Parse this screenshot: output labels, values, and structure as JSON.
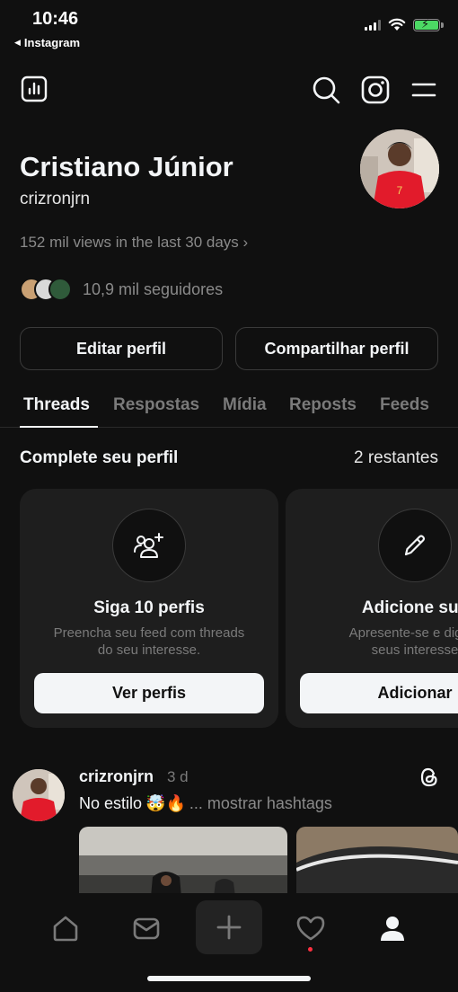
{
  "status_bar": {
    "time": "10:46",
    "back_app": "Instagram",
    "battery_color": "#4cd964"
  },
  "header": {
    "left_icon": "insights-chart-icon",
    "right_icons": [
      "search-icon",
      "instagram-icon",
      "menu-icon"
    ]
  },
  "profile": {
    "name": "Cristiano Júnior",
    "handle": "crizronjrn",
    "views": "152 mil views in the last 30 days",
    "followers": "10,9 mil seguidores",
    "edit_button": "Editar perfil",
    "share_button": "Compartilhar perfil"
  },
  "tabs": [
    {
      "label": "Threads",
      "active": true
    },
    {
      "label": "Respostas",
      "active": false
    },
    {
      "label": "Mídia",
      "active": false
    },
    {
      "label": "Reposts",
      "active": false
    },
    {
      "label": "Feeds",
      "active": false
    }
  ],
  "complete_profile": {
    "title": "Complete seu perfil",
    "remaining": "2 restantes",
    "cards": [
      {
        "icon": "add-people-icon",
        "title": "Siga 10 perfis",
        "description": "Preencha seu feed com threads\ndo seu interesse.",
        "button": "Ver perfis"
      },
      {
        "icon": "pencil-icon",
        "title": "Adicione sua",
        "description": "Apresente-se e diga o\nseus interesse",
        "button": "Adicionar"
      }
    ]
  },
  "post": {
    "user": "crizronjrn",
    "time": "3 d",
    "text": "No estilo",
    "emojis": "🤯🔥",
    "hashtags": "... mostrar hashtags",
    "icon": "threads-icon"
  },
  "bottom_nav": {
    "items": [
      "home-icon",
      "inbox-icon",
      "create-icon",
      "activity-icon",
      "profile-icon"
    ],
    "notification_color": "#ff3040"
  },
  "colors": {
    "background": "#101010",
    "card": "#1e1e1e",
    "text_primary": "#f3f5f7",
    "text_secondary": "#7a7a7a"
  }
}
